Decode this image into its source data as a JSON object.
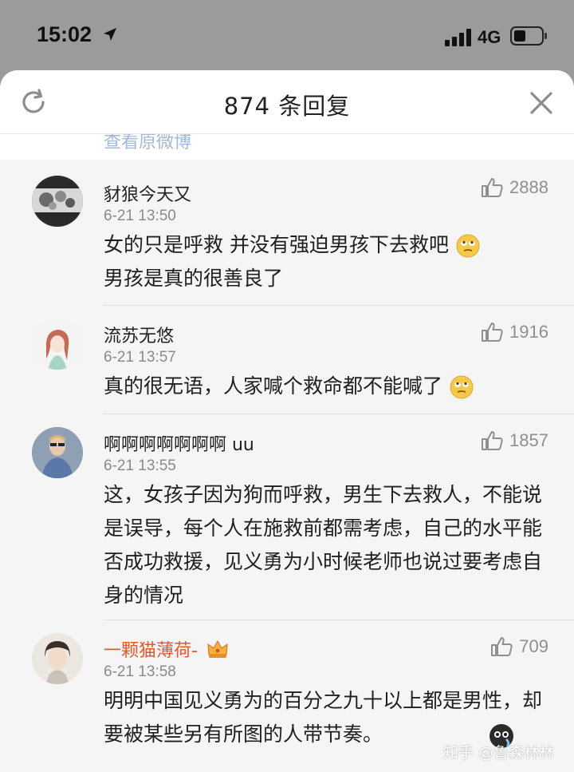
{
  "status_bar": {
    "time": "15:02",
    "network": "4G",
    "icons": [
      "location-arrow-icon",
      "signal-icon",
      "battery-icon"
    ]
  },
  "sheet": {
    "title": "874 条回复",
    "peek_text": "查看原微博",
    "icons": [
      "refresh-icon",
      "close-icon"
    ]
  },
  "comments": [
    {
      "author": "豺狼今天又",
      "time": "6-21 13:50",
      "likes": "2888",
      "text": "女的只是呼救 并没有强迫男孩下去救吧",
      "text2": "男孩是真的很善良了",
      "emoji": "eye-roll-emoji"
    },
    {
      "author": "流苏无悠",
      "time": "6-21 13:57",
      "likes": "1916",
      "text": "真的很无语，人家喊个救命都不能喊了",
      "emoji": "eye-roll-emoji"
    },
    {
      "author": "啊啊啊啊啊啊啊 uu",
      "time": "6-21 13:55",
      "likes": "1857",
      "text": "这，女孩子因为狗而呼救，男生下去救人，不能说是误导，每个人在施救前都需考虑，自己的水平能否成功救援，见义勇为小时候老师也说过要考虑自身的情况"
    },
    {
      "author": "一颗猫薄荷-",
      "time": "6-21 13:58",
      "likes": "709",
      "text": "明明中国见义勇为的百分之九十以上都是男性，却要被某些另有所图的人带节奏。",
      "badge": "crown-icon",
      "name_color": "#e8562a"
    }
  ],
  "watermark": "知乎 @鲁森林林",
  "colors": {
    "accent_link": "#5b7fb5",
    "vip_name": "#e8562a",
    "muted": "#8a8a8a"
  }
}
